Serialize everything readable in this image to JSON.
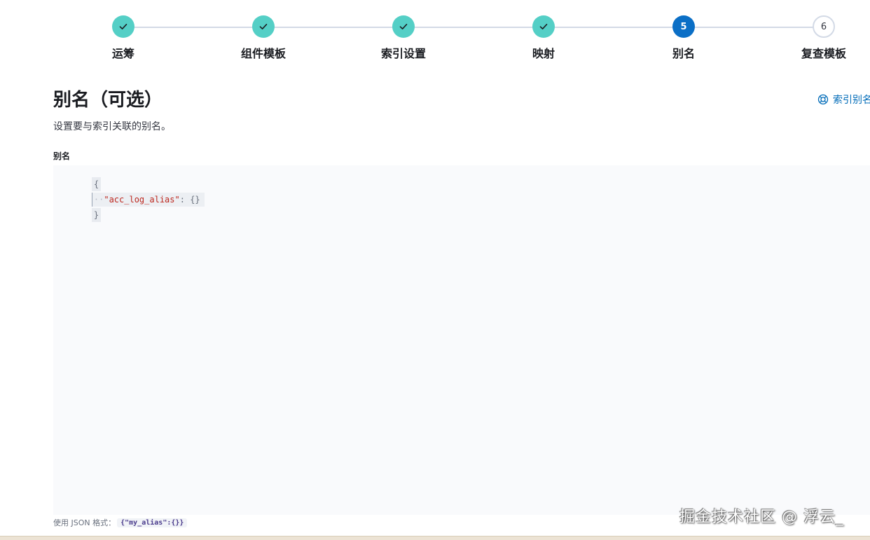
{
  "stepper": {
    "steps": [
      {
        "label": "运筹",
        "status": "complete"
      },
      {
        "label": "组件模板",
        "status": "complete"
      },
      {
        "label": "索引设置",
        "status": "complete"
      },
      {
        "label": "映射",
        "status": "complete"
      },
      {
        "label": "别名",
        "status": "current",
        "number": "5"
      },
      {
        "label": "复查模板",
        "status": "incomplete",
        "number": "6"
      }
    ]
  },
  "header": {
    "title": "别名（可选）",
    "description": "设置要与索引关联的别名。",
    "docs_link": "索引别名",
    "docs_icon": "lifebuoy-icon"
  },
  "editor": {
    "label": "别名",
    "lines": {
      "open_brace": "{",
      "indent": "··",
      "key": "\"acc_log_alias\"",
      "colon": ": ",
      "value": "{}",
      "close_brace": "}"
    }
  },
  "help": {
    "prefix": "使用 JSON 格式：",
    "example": "{\"my_alias\":{}}"
  },
  "watermark": "掘金技术社区 @ 浮云_",
  "colors": {
    "step_complete": "#54cfc6",
    "step_current": "#0b6fc6",
    "link": "#006bb8",
    "json_key": "#bd271e"
  }
}
